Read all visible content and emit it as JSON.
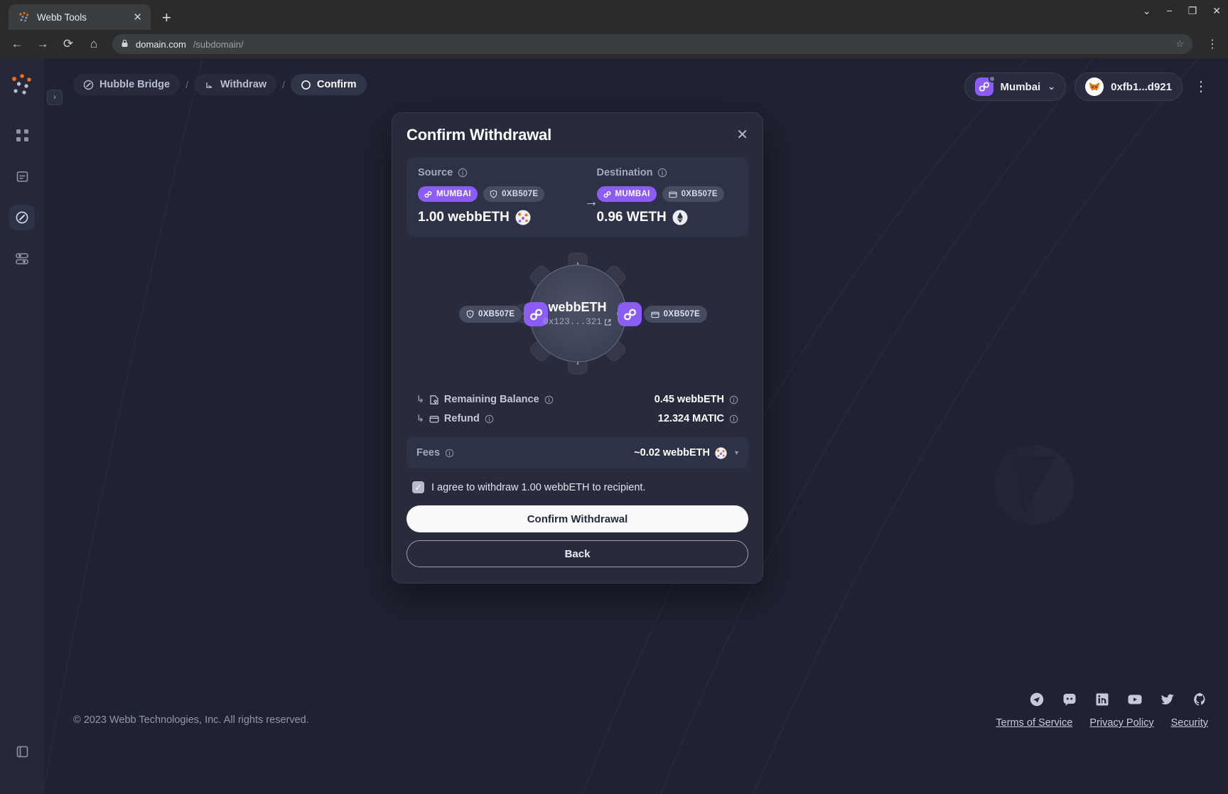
{
  "browser": {
    "tab": {
      "title": "Webb Tools",
      "favicon": "webb-logo-icon",
      "close": "✕"
    },
    "new_tab": "+",
    "window_controls": [
      "⌄",
      "−",
      "❐",
      "✕"
    ],
    "nav": {
      "back": "←",
      "forward": "→",
      "reload": "⟳",
      "home": "⌂"
    },
    "url": {
      "lock": "🔒",
      "main": "domain.com",
      "sub": "/subdomain/"
    },
    "bookmark": "☆",
    "menu": "⋮"
  },
  "sidebar": {
    "logo": "webb-logo-icon",
    "expand": "›",
    "items": [
      {
        "name": "apps-grid",
        "active": false
      },
      {
        "name": "documents",
        "active": false
      },
      {
        "name": "bridge",
        "active": true
      },
      {
        "name": "stats",
        "active": false
      }
    ],
    "bottom_item": {
      "name": "docs-book",
      "active": false
    }
  },
  "breadcrumb": [
    {
      "label": "Hubble Bridge",
      "icon": "disc-icon",
      "active": false
    },
    {
      "label": "Withdraw",
      "icon": "arrow-down-right-icon",
      "active": false
    },
    {
      "label": "Confirm",
      "icon": "circle-icon",
      "active": true
    }
  ],
  "breadcrumb_separator": "/",
  "topbar": {
    "chain": {
      "label": "Mumbai",
      "caret": "⌄",
      "icon": "webb-chain-icon"
    },
    "account": {
      "label": "0xfb1...d921",
      "icon": "metamask-fox-icon"
    },
    "menu": "⋮"
  },
  "modal": {
    "title": "Confirm Withdrawal",
    "close": "✕",
    "source": {
      "label": "Source",
      "chain_chip": "MUMBAI",
      "address_chip": "0XB507E",
      "amount": "1.00 webbETH",
      "token_icon": "webb-token-icon"
    },
    "arrow": "→",
    "destination": {
      "label": "Destination",
      "chain_chip": "MUMBAI",
      "address_chip": "0XB507E",
      "amount": "0.96 WETH",
      "token_icon": "eth-token-icon"
    },
    "diagram": {
      "left_chip": "0XB507E",
      "right_chip": "0XB507E",
      "center_token": "webbETH",
      "center_address": "0x123...321",
      "external_link": "↗"
    },
    "details": [
      {
        "label": "Remaining Balance",
        "value": "0.45 webbETH",
        "icon": "shield-doc-icon"
      },
      {
        "label": "Refund",
        "value": "12.324 MATIC",
        "icon": "wallet-icon"
      }
    ],
    "fees": {
      "label": "Fees",
      "value": "~0.02 webbETH",
      "token_icon": "webb-token-icon",
      "caret": "▾"
    },
    "agreement": {
      "checked": true,
      "text": "I agree to withdraw 1.00 webbETH to recipient.",
      "check": "✓"
    },
    "confirm_button": "Confirm Withdrawal",
    "back_button": "Back"
  },
  "footer": {
    "copyright": "© 2023 Webb Technologies, Inc. All rights reserved.",
    "socials": [
      "commit-icon",
      "telegram-icon",
      "discord-icon",
      "linkedin-icon",
      "youtube-icon",
      "twitter-icon",
      "github-icon"
    ],
    "links": [
      "Terms of Service",
      "Privacy Policy",
      "Security"
    ]
  },
  "colors": {
    "accent_purple": "#8b5cf6",
    "bg": "#1f2231",
    "panel": "#272b3c",
    "panel_inner": "#2e3246",
    "chip_grey": "#474c63"
  }
}
